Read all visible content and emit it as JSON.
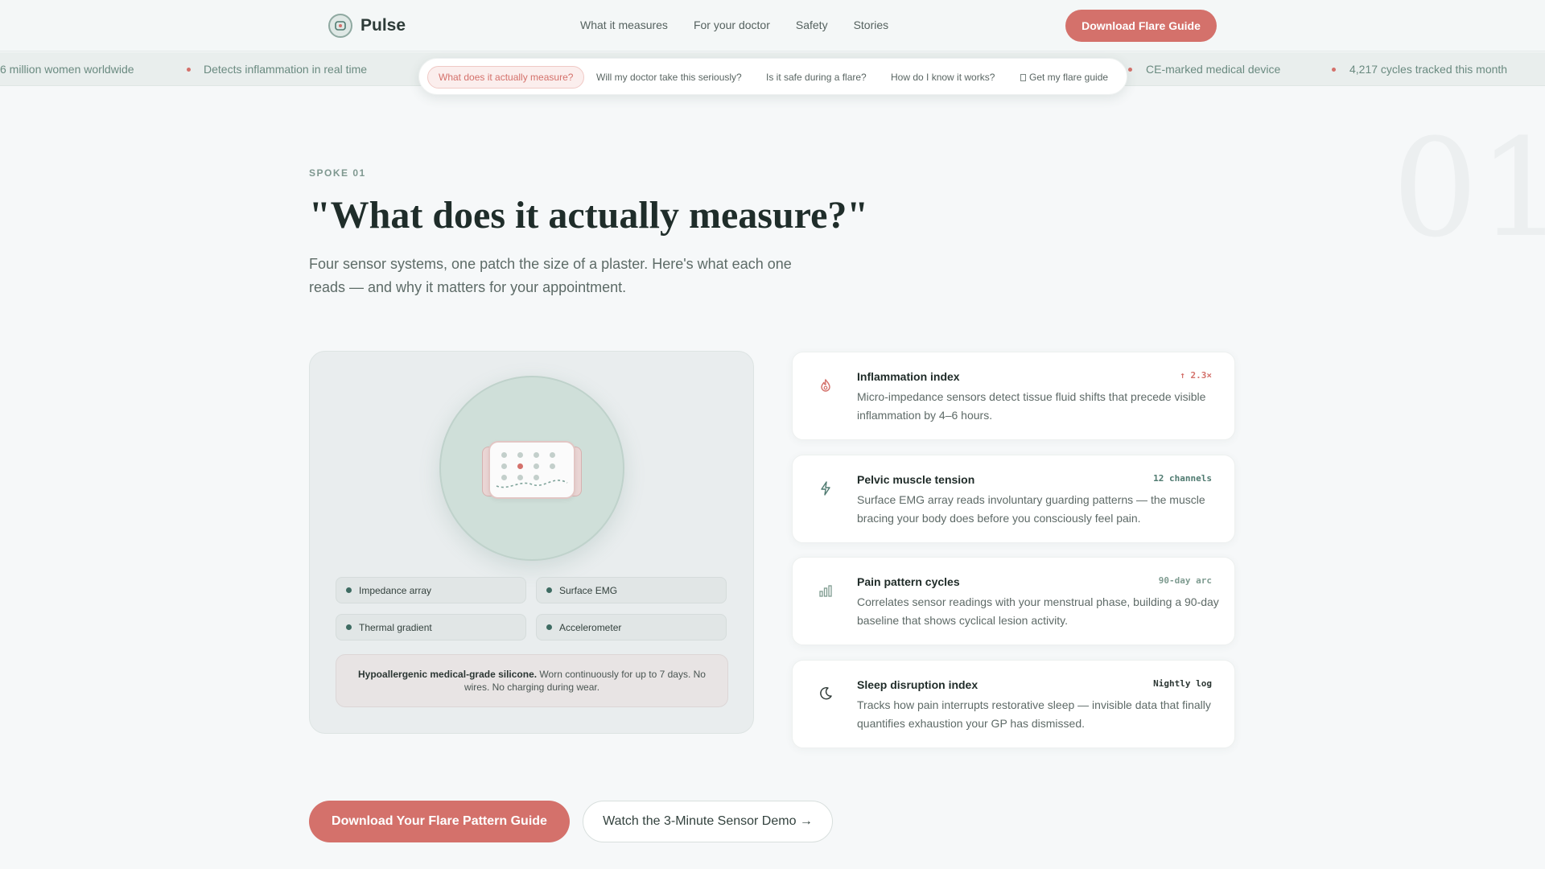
{
  "brand": {
    "name": "Pulse"
  },
  "nav": {
    "items": [
      {
        "label": "What it measures"
      },
      {
        "label": "For your doctor"
      },
      {
        "label": "Safety"
      },
      {
        "label": "Stories"
      }
    ],
    "cta_label": "Download Flare Guide"
  },
  "ticker": {
    "items": [
      "6 million women worldwide",
      "Detects inflammation in real time",
      "CE-marked medical device",
      "4,217 cycles tracked this month"
    ]
  },
  "questions": {
    "items": [
      {
        "label": "What does it actually measure?"
      },
      {
        "label": "Will my doctor take this seriously?"
      },
      {
        "label": "Is it safe during a flare?"
      },
      {
        "label": "How do I know it works?"
      },
      {
        "label": "Get my flare guide"
      }
    ]
  },
  "hero": {
    "number": "01",
    "eyebrow": "SPOKE 01",
    "title": "\"What does it actually measure?\"",
    "lead": "Four sensor systems, one patch the size of a plaster. Here's what each one reads — and why it matters for your appointment."
  },
  "device": {
    "sensors": [
      "Impedance array",
      "Surface EMG",
      "Thermal gradient",
      "Accelerometer"
    ],
    "material_bold": "Hypoallergenic medical-grade silicone.",
    "material_text": " Worn continuously for up to 7 days. No wires. No charging during wear."
  },
  "measures": [
    {
      "icon": "flame-icon",
      "title": "Inflammation index",
      "tag": "↑ 2.3×",
      "tag_color": "#d4716b",
      "desc": "Micro-impedance sensors detect tissue fluid shifts that precede visible inflammation by 4–6 hours."
    },
    {
      "icon": "lightning-icon",
      "title": "Pelvic muscle tension",
      "tag": "12 channels",
      "tag_color": "#4f7a70",
      "desc": "Surface EMG array reads involuntary guarding patterns — the muscle bracing your body does before you consciously feel pain."
    },
    {
      "icon": "bar-chart-icon",
      "title": "Pain pattern cycles",
      "tag": "90-day arc",
      "tag_color": "#7e9b90",
      "desc": "Correlates sensor readings with your menstrual phase, building a 90-day baseline that shows cyclical lesion activity."
    },
    {
      "icon": "moon-icon",
      "title": "Sleep disruption index",
      "tag": "Nightly log",
      "tag_color": "#2b3633",
      "desc": "Tracks how pain interrupts restorative sleep — invisible data that finally quantifies exhaustion your GP has dismissed."
    }
  ],
  "ctas": {
    "primary": "Download Your Flare Pattern Guide",
    "secondary": "Watch the 3-Minute Sensor Demo →"
  },
  "colors": {
    "accent": "#d4716b",
    "teal": "#3e6b62",
    "background": "#f6f8f9"
  }
}
